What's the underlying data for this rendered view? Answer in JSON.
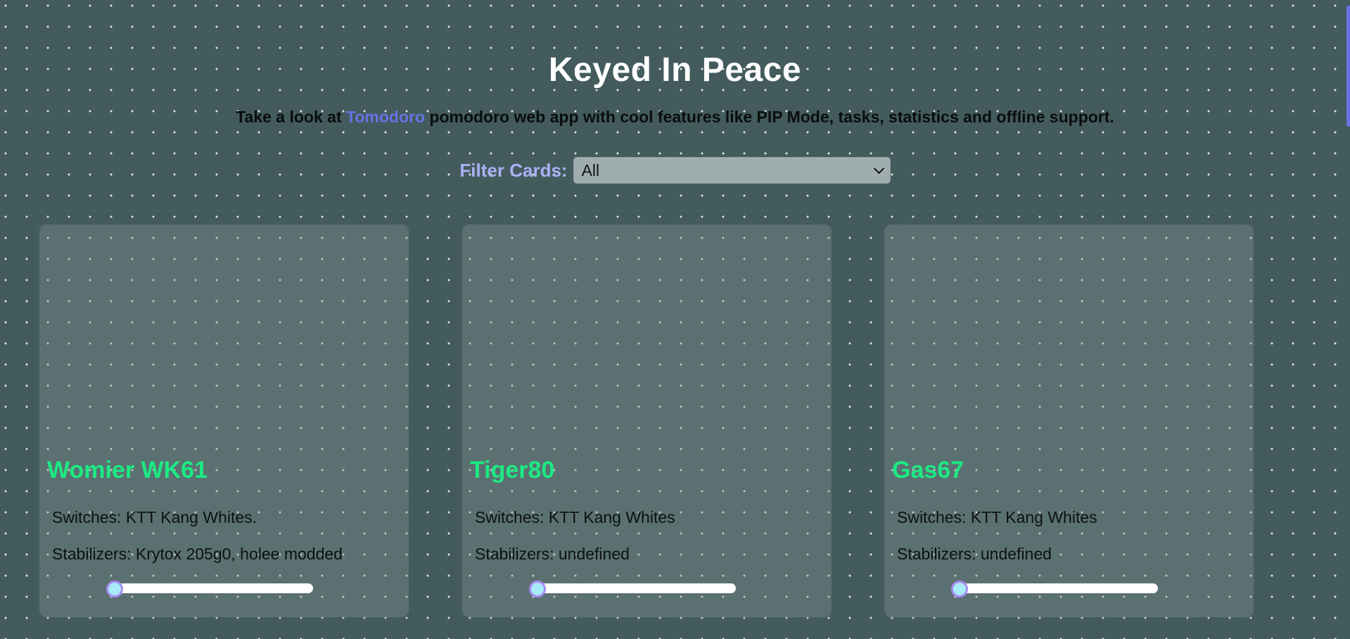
{
  "header": {
    "title": "Keyed In Peace",
    "subtitle_before": "Take a look at ",
    "subtitle_link": "Tomodoro",
    "subtitle_after": " pomodoro web app with cool features like PIP Mode, tasks, statistics and offline support."
  },
  "filter": {
    "label": "Filter Cards:",
    "selected": "All"
  },
  "cards": [
    {
      "name": "Womier WK61",
      "switches": "Switches: KTT Kang Whites.",
      "stabilizers": "Stabilizers: Krytox 205g0, holee modded",
      "slider_value": 0
    },
    {
      "name": "Tiger80",
      "switches": "Switches: KTT Kang Whites",
      "stabilizers": "Stabilizers: undefined",
      "slider_value": 0
    },
    {
      "name": "Gas67",
      "switches": "Switches: KTT Kang Whites",
      "stabilizers": "Stabilizers: undefined",
      "slider_value": 0
    }
  ],
  "colors": {
    "background": "#435b5c",
    "accent": "#6474e5",
    "card_title": "#1cea83",
    "filter_label": "#a7b2f4"
  }
}
